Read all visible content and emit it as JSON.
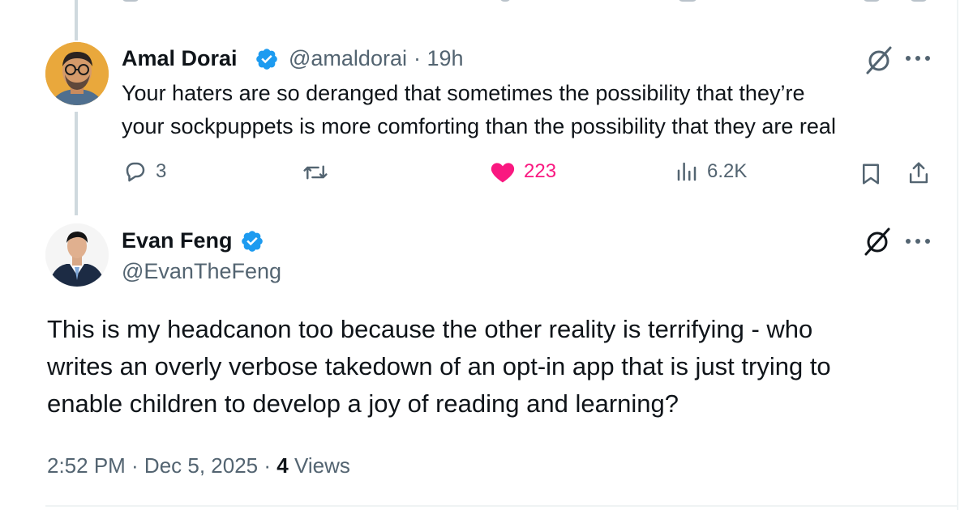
{
  "reply": {
    "author_name": "Amal Dorai",
    "handle": "@amaldorai",
    "time": "· 19h",
    "text_line1": "Your haters are so deranged that sometimes the possibility that they’re",
    "text_line2": "your sockpuppets is more comforting than the possibility that they are real",
    "replies": "3",
    "likes": "223",
    "views": "6.2K"
  },
  "main": {
    "author_name": "Evan Feng",
    "handle": "@EvanTheFeng",
    "text_line1": "This is my headcanon too because the other reality is terrifying - who",
    "text_line2": "writes an overly verbose takedown of an opt-in app that is just trying to",
    "text_line3": "enable children to develop a joy of reading and learning?",
    "time": "2:52 PM · Dec 5, 2025 ·",
    "views_count": "4",
    "views_label": "Views"
  },
  "colors": {
    "verified_blue": "#1d9bf0",
    "like_pink": "#f91880",
    "secondary_text": "#536471"
  },
  "icons": [
    "verified-badge-icon",
    "grok-icon",
    "more-icon",
    "reply-icon",
    "repost-icon",
    "heart-icon",
    "views-icon",
    "bookmark-icon",
    "share-icon"
  ]
}
